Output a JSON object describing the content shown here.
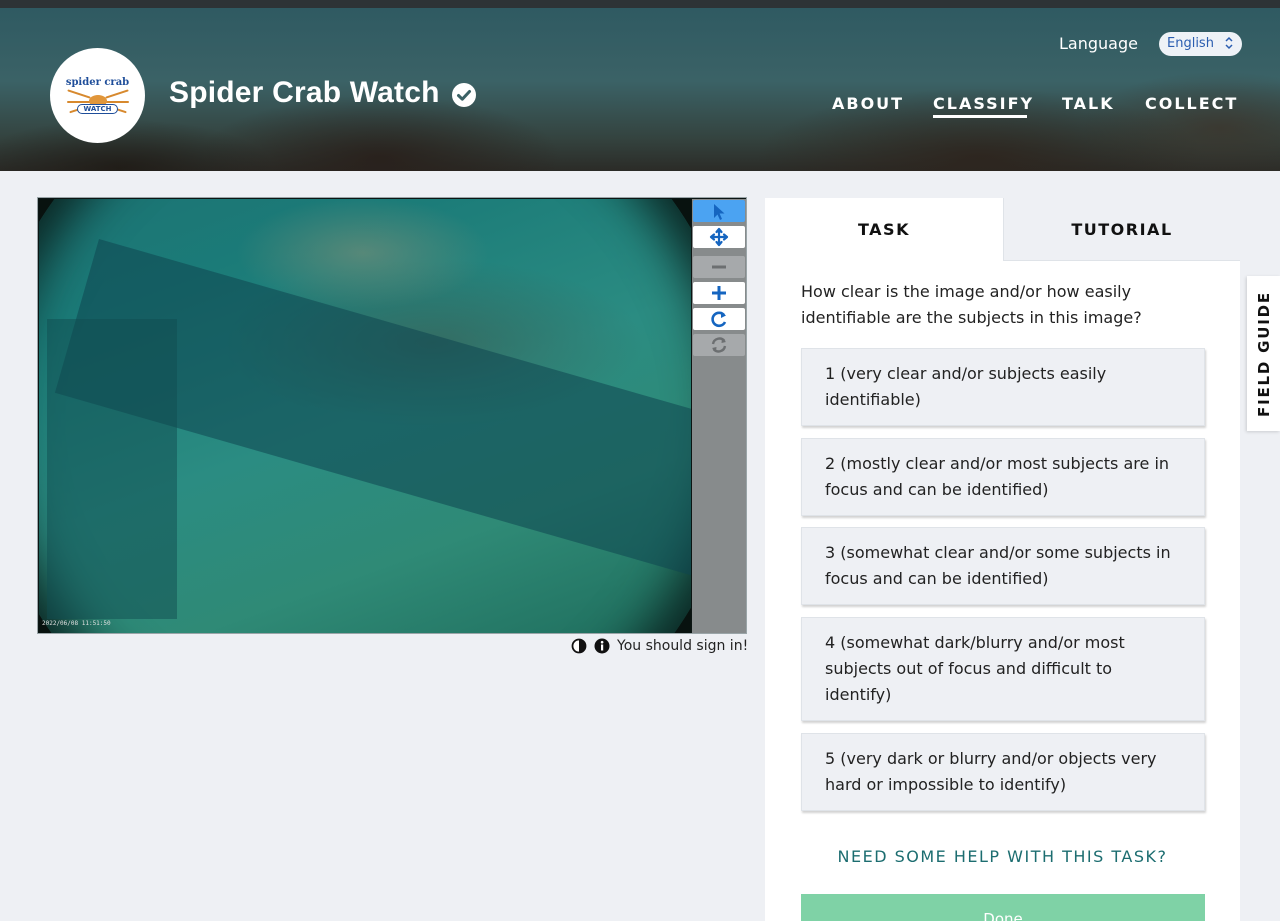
{
  "header": {
    "site_title": "Spider Crab Watch",
    "logo_top_text": "spider crab",
    "logo_bottom_text": "WATCH",
    "language_label": "Language",
    "language_value": "English",
    "nav": [
      {
        "label": "ABOUT",
        "active": false
      },
      {
        "label": "CLASSIFY",
        "active": true
      },
      {
        "label": "TALK",
        "active": false
      },
      {
        "label": "COLLECT",
        "active": false
      }
    ]
  },
  "viewer": {
    "timestamp": "2022/06/08 11:51:50",
    "tools": [
      "pointer-icon",
      "move-icon",
      "zoom-out-icon",
      "zoom-in-icon",
      "rotate-icon",
      "reset-icon"
    ],
    "sign_in_text": "You should sign in!"
  },
  "task_panel": {
    "tabs": [
      {
        "label": "TASK",
        "active": true
      },
      {
        "label": "TUTORIAL",
        "active": false
      }
    ],
    "question": "How clear is the image and/or how easily identifiable are the subjects in this image?",
    "answers": [
      "1 (very clear and/or subjects easily identifiable)",
      "2 (mostly clear and/or most subjects are in focus and can be identified)",
      "3 (somewhat clear and/or some subjects in focus and can be identified)",
      "4 (somewhat dark/blurry and/or most subjects out of focus and difficult to identify)",
      "5 (very dark or blurry and/or objects very hard or impossible to identify)"
    ],
    "help_link": "NEED SOME HELP WITH THIS TASK?",
    "done_label": "Done"
  },
  "field_guide_label": "FIELD GUIDE",
  "colors": {
    "accent_blue": "#4ba3f2",
    "help_teal": "#1c6d70",
    "done_green": "#7fd2a6",
    "page_bg": "#eef0f4"
  }
}
